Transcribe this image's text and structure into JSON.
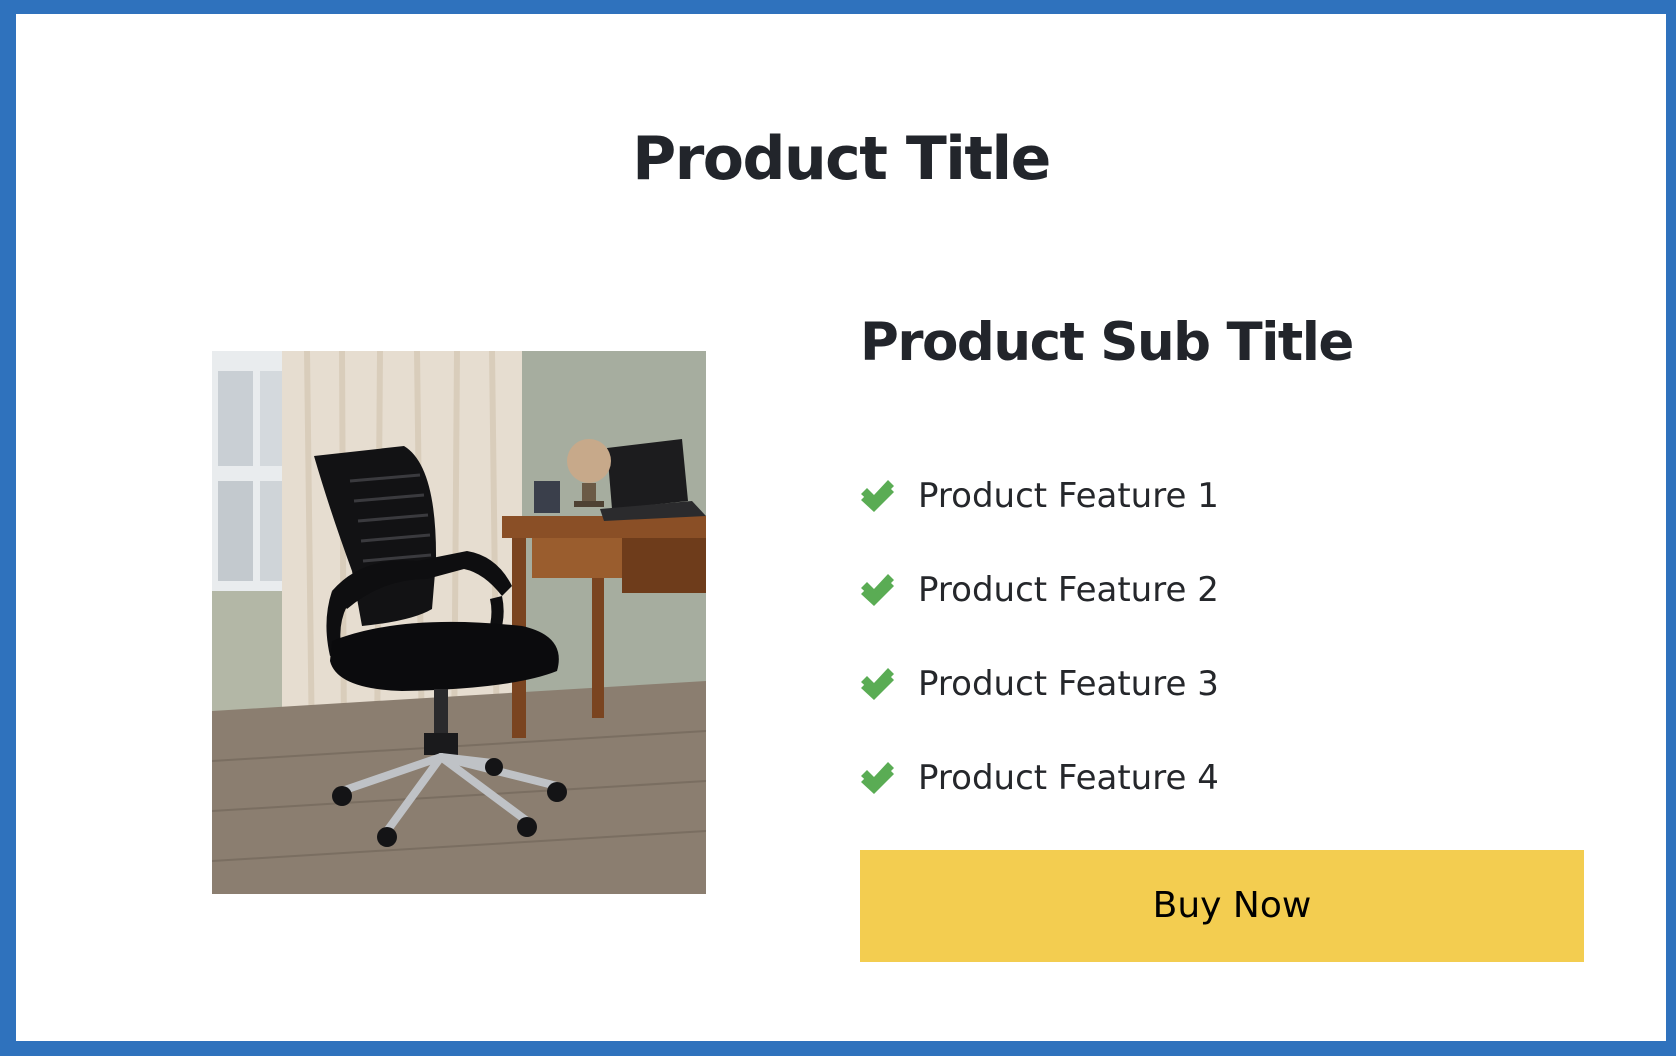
{
  "product": {
    "title": "Product Title",
    "sub_title": "Product Sub Title",
    "image": {
      "icon": "office-chair-photo",
      "alt": "Black mesh office chair beside a wooden desk with a laptop and globe"
    },
    "features": [
      {
        "label": "Product Feature 1",
        "icon": "check-double-icon"
      },
      {
        "label": "Product Feature 2",
        "icon": "check-double-icon"
      },
      {
        "label": "Product Feature 3",
        "icon": "check-double-icon"
      },
      {
        "label": "Product Feature 4",
        "icon": "check-double-icon"
      }
    ],
    "buy_button_label": "Buy Now"
  },
  "colors": {
    "border": "#2f72bd",
    "background": "#ffffff",
    "heading": "#22252b",
    "check": "#5aac54",
    "button": "#f3cd50",
    "button_text": "#000000"
  }
}
